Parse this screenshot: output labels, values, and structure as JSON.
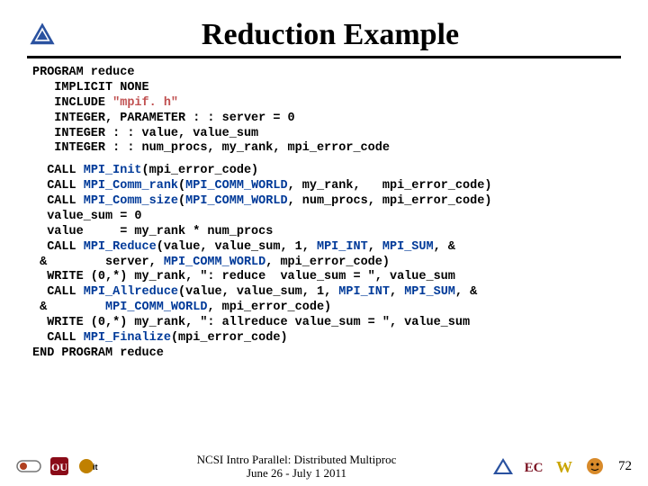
{
  "title": "Reduction Example",
  "code_block1": [
    {
      "segs": [
        {
          "t": "PROGRAM reduce",
          "c": "kw"
        }
      ]
    },
    {
      "segs": [
        {
          "t": "   IMPLICIT NONE",
          "c": "kw"
        }
      ]
    },
    {
      "segs": [
        {
          "t": "   INCLUDE ",
          "c": "kw"
        },
        {
          "t": "\"mpif. h\"",
          "c": "str"
        }
      ]
    },
    {
      "segs": [
        {
          "t": "   INTEGER, PARAMETER : : server = 0",
          "c": "kw"
        }
      ]
    },
    {
      "segs": [
        {
          "t": "   INTEGER : : value, value_sum",
          "c": "kw"
        }
      ]
    },
    {
      "segs": [
        {
          "t": "   INTEGER : : num_procs, my_rank, mpi_error_code",
          "c": "kw"
        }
      ]
    }
  ],
  "code_block2": [
    {
      "segs": [
        {
          "t": "  CALL ",
          "c": "kw"
        },
        {
          "t": "MPI_Init",
          "c": "mpi"
        },
        {
          "t": "(mpi_error_code)",
          "c": "kw"
        }
      ]
    },
    {
      "segs": [
        {
          "t": "  CALL ",
          "c": "kw"
        },
        {
          "t": "MPI_Comm_rank",
          "c": "mpi"
        },
        {
          "t": "(",
          "c": "kw"
        },
        {
          "t": "MPI_COMM_WORLD",
          "c": "mpi"
        },
        {
          "t": ", my_rank,   mpi_error_code)",
          "c": "kw"
        }
      ]
    },
    {
      "segs": [
        {
          "t": "  CALL ",
          "c": "kw"
        },
        {
          "t": "MPI_Comm_size",
          "c": "mpi"
        },
        {
          "t": "(",
          "c": "kw"
        },
        {
          "t": "MPI_COMM_WORLD",
          "c": "mpi"
        },
        {
          "t": ", num_procs, mpi_error_code)",
          "c": "kw"
        }
      ]
    },
    {
      "segs": [
        {
          "t": "  value_sum = 0",
          "c": "kw"
        }
      ]
    },
    {
      "segs": [
        {
          "t": "  value     = my_rank * num_procs",
          "c": "kw"
        }
      ]
    },
    {
      "segs": [
        {
          "t": "  CALL ",
          "c": "kw"
        },
        {
          "t": "MPI_Reduce",
          "c": "mpi"
        },
        {
          "t": "(value, value_sum, 1, ",
          "c": "kw"
        },
        {
          "t": "MPI_INT",
          "c": "mpi"
        },
        {
          "t": ", ",
          "c": "kw"
        },
        {
          "t": "MPI_SUM",
          "c": "mpi"
        },
        {
          "t": ", &",
          "c": "kw"
        }
      ]
    },
    {
      "segs": [
        {
          "t": " &        server, ",
          "c": "kw"
        },
        {
          "t": "MPI_COMM_WORLD",
          "c": "mpi"
        },
        {
          "t": ", mpi_error_code)",
          "c": "kw"
        }
      ]
    },
    {
      "segs": [
        {
          "t": "  WRITE (0,*) my_rank, \": reduce  value_sum = \", value_sum",
          "c": "kw"
        }
      ]
    },
    {
      "segs": [
        {
          "t": "  CALL ",
          "c": "kw"
        },
        {
          "t": "MPI_Allreduce",
          "c": "mpi"
        },
        {
          "t": "(value, value_sum, 1, ",
          "c": "kw"
        },
        {
          "t": "MPI_INT",
          "c": "mpi"
        },
        {
          "t": ", ",
          "c": "kw"
        },
        {
          "t": "MPI_SUM",
          "c": "mpi"
        },
        {
          "t": ", &",
          "c": "kw"
        }
      ]
    },
    {
      "segs": [
        {
          "t": " &        ",
          "c": "kw"
        },
        {
          "t": "MPI_COMM_WORLD",
          "c": "mpi"
        },
        {
          "t": ", mpi_error_code)",
          "c": "kw"
        }
      ]
    },
    {
      "segs": [
        {
          "t": "  WRITE (0,*) my_rank, \": allreduce value_sum = \", value_sum",
          "c": "kw"
        }
      ]
    },
    {
      "segs": [
        {
          "t": "  CALL ",
          "c": "kw"
        },
        {
          "t": "MPI_Finalize",
          "c": "mpi"
        },
        {
          "t": "(mpi_error_code)",
          "c": "kw"
        }
      ]
    },
    {
      "segs": [
        {
          "t": "END PROGRAM reduce",
          "c": "kw"
        }
      ]
    }
  ],
  "footer": {
    "line1": "NCSI Intro Parallel: Distributed Multiproc",
    "line2": "June 26 - July 1 2011"
  },
  "page_number": "72",
  "logos": {
    "tri": "triangle-logo",
    "oscer": "OSCER",
    "ou": "OU",
    "it": "IT",
    "minitri": "triangle",
    "ec": "EC",
    "w": "W",
    "tiger": "tiger"
  }
}
